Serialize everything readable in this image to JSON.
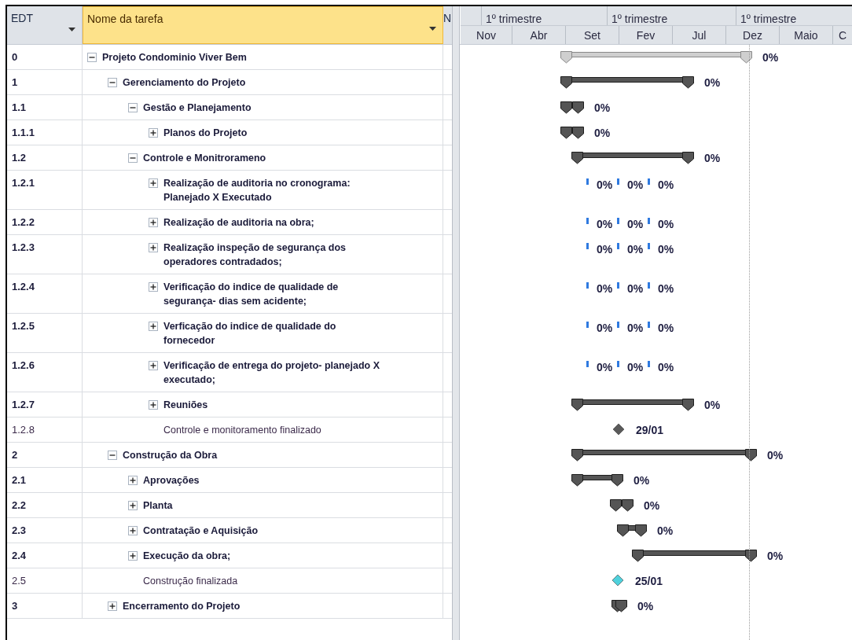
{
  "table": {
    "columns": [
      {
        "label": "EDT",
        "selected": false,
        "menu": true
      },
      {
        "label": "Nome da tarefa",
        "selected": true,
        "menu": true
      },
      {
        "label": "N",
        "selected": false,
        "menu": false
      }
    ]
  },
  "timescale": {
    "top": [
      "1º trimestre",
      "1º trimestre",
      "1º trimestre"
    ],
    "bottom": [
      "Nov",
      "Abr",
      "Set",
      "Fev",
      "Jul",
      "Dez",
      "Maio",
      "C"
    ]
  },
  "tasks": [
    {
      "edt": "0",
      "name": "Projeto Condominio Viver Bem",
      "kind": "summary",
      "expanded": true,
      "bar": {
        "kind": "project",
        "labels": [
          "0%"
        ]
      },
      "children": [
        {
          "edt": "1",
          "name": "Gerenciamento do Projeto",
          "kind": "summary",
          "expanded": true,
          "bar": {
            "kind": "summary",
            "labels": [
              "0%"
            ]
          },
          "children": [
            {
              "edt": "1.1",
              "name": "Gestão e Planejamento",
              "kind": "summary",
              "expanded": true,
              "bar": {
                "kind": "summary",
                "labels": [
                  "0%"
                ]
              },
              "children": [
                {
                  "edt": "1.1.1",
                  "name": "Planos do Projeto",
                  "kind": "summary",
                  "expanded": false,
                  "bar": {
                    "kind": "summary",
                    "labels": [
                      "0%"
                    ]
                  }
                }
              ]
            },
            {
              "edt": "1.2",
              "name": "Controle e Monitrorameno",
              "kind": "summary",
              "expanded": true,
              "bar": {
                "kind": "summary",
                "labels": [
                  "0%"
                ]
              },
              "children": [
                {
                  "edt": "1.2.1",
                  "name": "Realização de auditoria no cronograma: Planejado X Executado",
                  "kind": "summary",
                  "expanded": false,
                  "bar": {
                    "kind": "ticks",
                    "labels": [
                      "0%",
                      "0%",
                      "0%"
                    ]
                  }
                },
                {
                  "edt": "1.2.2",
                  "name": "Realização de auditoria na obra;",
                  "kind": "summary",
                  "expanded": false,
                  "bar": {
                    "kind": "ticks",
                    "labels": [
                      "0%",
                      "0%",
                      "0%"
                    ]
                  }
                },
                {
                  "edt": "1.2.3",
                  "name": "Realização inspeção de segurança dos operadores contradados;",
                  "kind": "summary",
                  "expanded": false,
                  "bar": {
                    "kind": "ticks",
                    "labels": [
                      "0%",
                      "0%",
                      "0%"
                    ]
                  }
                },
                {
                  "edt": "1.2.4",
                  "name": "Verificação do indice de qualidade de segurança- dias sem acidente;",
                  "kind": "summary",
                  "expanded": false,
                  "bar": {
                    "kind": "ticks",
                    "labels": [
                      "0%",
                      "0%",
                      "0%"
                    ]
                  }
                },
                {
                  "edt": "1.2.5",
                  "name": "Verficação do indice de qualidade do fornecedor",
                  "kind": "summary",
                  "expanded": false,
                  "bar": {
                    "kind": "ticks",
                    "labels": [
                      "0%",
                      "0%",
                      "0%"
                    ]
                  }
                },
                {
                  "edt": "1.2.6",
                  "name": "Verificação  de entrega do projeto- planejado X executado;",
                  "kind": "summary",
                  "expanded": false,
                  "bar": {
                    "kind": "ticks",
                    "labels": [
                      "0%",
                      "0%",
                      "0%"
                    ]
                  }
                },
                {
                  "edt": "1.2.7",
                  "name": "Reuniões",
                  "kind": "summary",
                  "expanded": false,
                  "bar": {
                    "kind": "summary",
                    "labels": [
                      "0%"
                    ]
                  }
                },
                {
                  "edt": "1.2.8",
                  "name": "Controle e monitoramento finalizado",
                  "kind": "milestone",
                  "bar": {
                    "kind": "milestone",
                    "color": "#5a5a5a",
                    "labels": [
                      "29/01"
                    ]
                  }
                }
              ]
            }
          ]
        },
        {
          "edt": "2",
          "name": "Construção da Obra",
          "kind": "summary",
          "expanded": true,
          "bar": {
            "kind": "summary",
            "labels": [
              "0%"
            ]
          },
          "children": [
            {
              "edt": "2.1",
              "name": "Aprovações",
              "kind": "summary",
              "expanded": false,
              "bar": {
                "kind": "summary",
                "labels": [
                  "0%"
                ]
              }
            },
            {
              "edt": "2.2",
              "name": "Planta",
              "kind": "summary",
              "expanded": false,
              "bar": {
                "kind": "summary",
                "labels": [
                  "0%"
                ]
              }
            },
            {
              "edt": "2.3",
              "name": "Contratação e Aquisição",
              "kind": "summary",
              "expanded": false,
              "bar": {
                "kind": "summary",
                "labels": [
                  "0%"
                ]
              }
            },
            {
              "edt": "2.4",
              "name": "Execução da obra;",
              "kind": "summary",
              "expanded": false,
              "bar": {
                "kind": "summary",
                "labels": [
                  "0%"
                ]
              }
            },
            {
              "edt": "2.5",
              "name": "Construção finalizada",
              "kind": "milestone",
              "bar": {
                "kind": "milestone",
                "color": "#4fd1dc",
                "labels": [
                  "25/01"
                ]
              }
            }
          ]
        },
        {
          "edt": "3",
          "name": "Encerramento do Projeto",
          "kind": "summary",
          "expanded": false,
          "bar": {
            "kind": "summary",
            "labels": [
              "0%"
            ]
          }
        }
      ]
    }
  ]
}
